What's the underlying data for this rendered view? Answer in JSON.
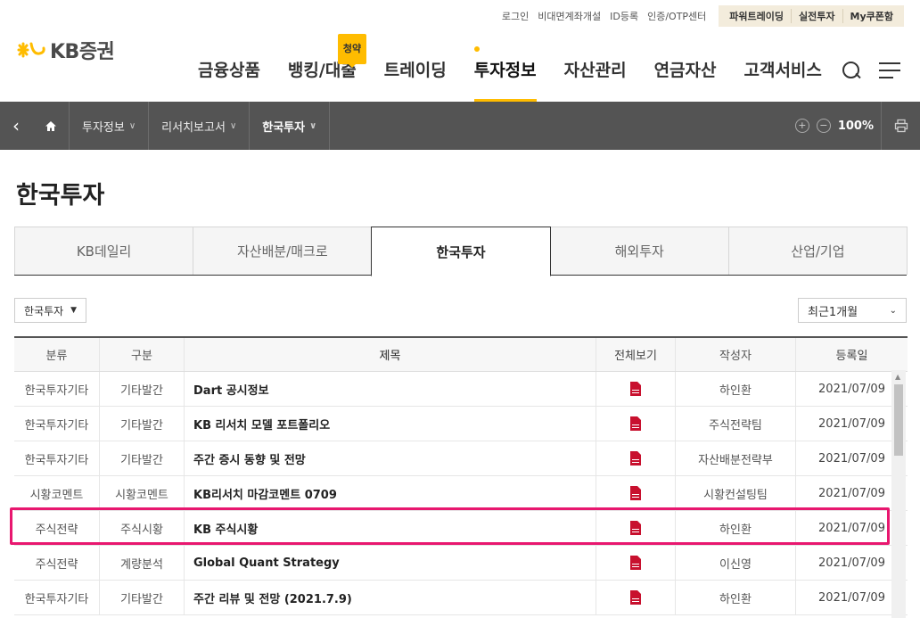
{
  "utility": {
    "links": [
      "로그인",
      "비대면계좌개설",
      "ID등록",
      "인증/OTP센터"
    ],
    "boxed": [
      "파워트레이딩",
      "실전투자",
      "My쿠폰함"
    ]
  },
  "logo": {
    "text": "KB증권",
    "color": "#ffbc00"
  },
  "nav": {
    "items": [
      "금융상품",
      "뱅킹/대출",
      "트레이딩",
      "투자정보",
      "자산관리",
      "연금자산",
      "고객서비스"
    ],
    "active_index": 3,
    "badge": "청약"
  },
  "breadcrumb": {
    "segments": [
      "투자정보",
      "리서치보고서",
      "한국투자"
    ],
    "zoom": "100%"
  },
  "page": {
    "title": "한국투자"
  },
  "tabs": [
    "KB데일리",
    "자산배분/매크로",
    "한국투자",
    "해외투자",
    "산업/기업"
  ],
  "filters": {
    "category": "한국투자",
    "period": "최근1개월"
  },
  "table": {
    "headers": [
      "분류",
      "구분",
      "제목",
      "전체보기",
      "작성자",
      "등록일"
    ],
    "rows": [
      [
        "한국투자기타",
        "기타발간",
        "Dart 공시정보",
        "하인환",
        "2021/07/09"
      ],
      [
        "한국투자기타",
        "기타발간",
        "KB 리서치 모델 포트폴리오",
        "주식전략팀",
        "2021/07/09"
      ],
      [
        "한국투자기타",
        "기타발간",
        "주간 증시 동향 및 전망",
        "자산배분전략부",
        "2021/07/09"
      ],
      [
        "시황코멘트",
        "시황코멘트",
        "KB리서치 마감코멘트 0709",
        "시황컨설팅팀",
        "2021/07/09"
      ],
      [
        "주식전략",
        "주식시황",
        "KB 주식시황",
        "하인환",
        "2021/07/09"
      ],
      [
        "주식전략",
        "계량분석",
        "Global Quant Strategy",
        "이신영",
        "2021/07/09"
      ],
      [
        "한국투자기타",
        "기타발간",
        "주간 리뷰 및 전망 (2021.7.9)",
        "하인환",
        "2021/07/09"
      ]
    ]
  },
  "colors": {
    "accent": "#ffbc00",
    "highlight": "#e8176f",
    "crumb_bg": "#545454",
    "pdf_red": "#c8102e"
  }
}
